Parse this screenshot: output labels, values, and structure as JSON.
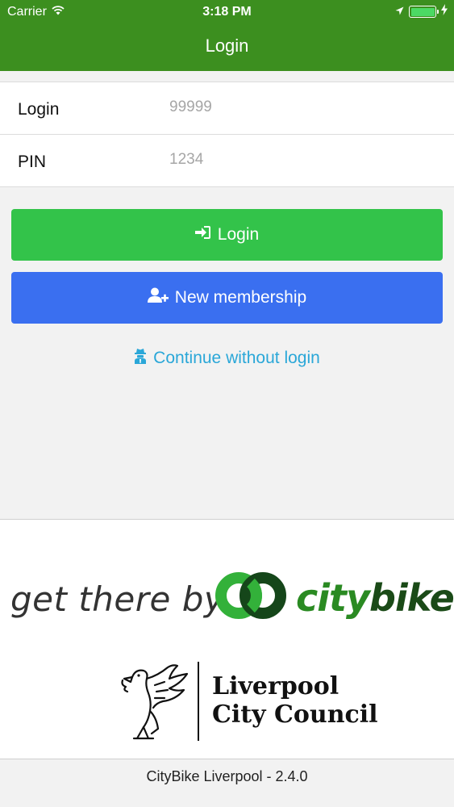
{
  "status_bar": {
    "carrier": "Carrier",
    "time": "3:18 PM",
    "battery_level": 1.0,
    "icons": [
      "wifi-icon",
      "location-arrow-icon",
      "battery-icon",
      "charging-bolt-icon"
    ]
  },
  "nav": {
    "title": "Login"
  },
  "form": {
    "login_label": "Login",
    "login_placeholder": "99999",
    "pin_label": "PIN",
    "pin_placeholder": "1234"
  },
  "buttons": {
    "login_label": "Login",
    "login_icon": "sign-in-icon",
    "login_color": "#33c34a",
    "membership_label": "New membership",
    "membership_icon": "user-plus-icon",
    "membership_color": "#3a6ff0"
  },
  "continue": {
    "label": "Continue without login",
    "icon": "user-secret-icon",
    "color": "#2aa7d8"
  },
  "branding": {
    "tagline": "get there by",
    "logo_city": "city",
    "logo_bike": "bike",
    "council_line1": "Liverpool",
    "council_line2": "City Council"
  },
  "footer": {
    "version_text": "CityBike Liverpool - 2.4.0"
  },
  "colors": {
    "navbar": "#3c8f1f",
    "background": "#f2f2f2"
  }
}
